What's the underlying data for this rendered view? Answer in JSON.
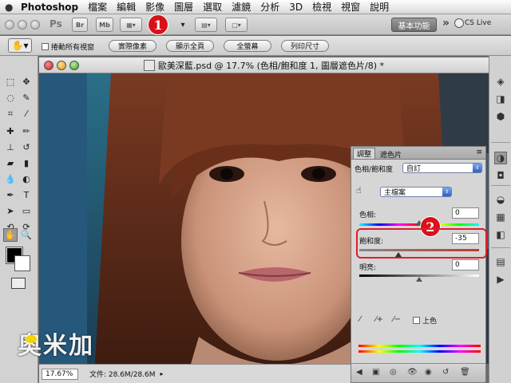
{
  "menubar": {
    "app_name": "Photoshop",
    "items": [
      "檔案",
      "編輯",
      "影像",
      "圖層",
      "選取",
      "濾鏡",
      "分析",
      "3D",
      "檢視",
      "視窗",
      "說明"
    ]
  },
  "appbar": {
    "ps_label": "Ps",
    "br_label": "Br",
    "mb_label": "Mb",
    "step1": "1",
    "workspace_label": "基本功能",
    "cslive_label": "CS Live"
  },
  "options": {
    "scroll_all_label": "捲動所有視窗",
    "buttons": [
      "實際像素",
      "顯示全頁",
      "全螢幕",
      "列印尺寸"
    ]
  },
  "document": {
    "title": "歐美深藍.psd @ 17.7% (色相/飽和度 1, 圖層遮色片/8) *",
    "zoom": "17.67%",
    "info": "文件: 28.6M/28.6M"
  },
  "watermark": "奥米加",
  "adjustments": {
    "tabs": [
      "調整",
      "遮色片"
    ],
    "preset_label": "色相/飽和度",
    "preset_value": "自訂",
    "channel_value": "主檔案",
    "hue_label": "色相:",
    "hue_value": "0",
    "saturation_label": "飽和度:",
    "saturation_value": "-35",
    "lightness_label": "明亮:",
    "lightness_value": "0",
    "colorize_label": "上色",
    "step2": "2"
  }
}
